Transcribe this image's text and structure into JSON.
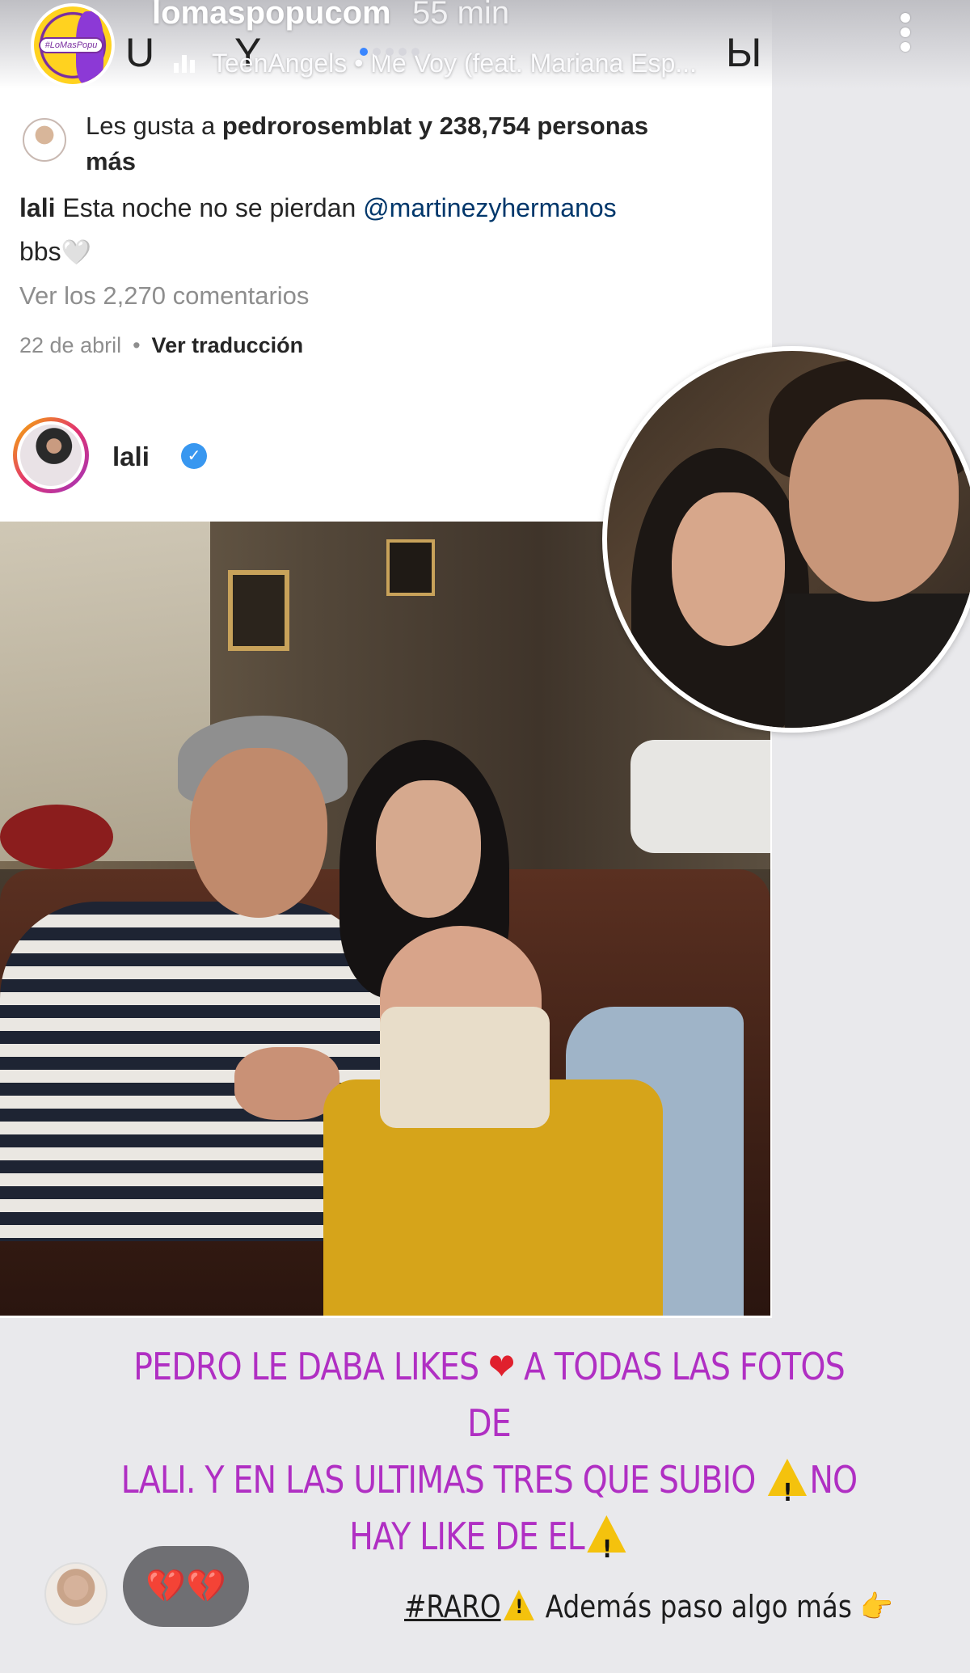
{
  "story": {
    "username": "lomaspopucom",
    "time": "55 min",
    "song": "TeenAngels • Me Voy (feat. Mariana Esp...",
    "logo_text": "#LoMasPopu"
  },
  "post": {
    "likes_prefix": "Les gusta a ",
    "likes_user": "pedrorosemblat",
    "likes_suffix": " y 238,754 personas más",
    "caption_user": "lali",
    "caption_text": " Esta noche no se pierdan ",
    "caption_mention": "@martinezyhermanos",
    "caption_end": "bbs",
    "caption_heart": "🤍",
    "view_comments": "Ver los 2,270 comentarios",
    "date": "22 de abril",
    "dot": "•",
    "translate": "Ver traducción",
    "author": "lali",
    "verified_glyph": "✓"
  },
  "overlay": {
    "line1a": "PEDRO LE DABA LIKES",
    "heart": "❤",
    "line1b": " A TODAS LAS FOTOS DE",
    "line2": "LALI. Y EN LAS ULTIMAS TRES QUE SUBIO ",
    "line2b": "NO",
    "line3": "HAY LIKE DE EL"
  },
  "footer": {
    "reply_emoji": "💔💔",
    "hashtag": "#RARO",
    "hashtag_rest": " Además paso algo más ",
    "point_glyph": "👉"
  },
  "icons": {
    "warning": "warning-icon",
    "verified": "verified-badge-icon",
    "more": "more-vertical-icon",
    "music": "music-bars-icon"
  },
  "colors": {
    "overlay_text": "#b02fc3",
    "mention": "#00376b",
    "verified": "#3897f0",
    "warning": "#f4c20d",
    "heart": "#e0202d"
  }
}
